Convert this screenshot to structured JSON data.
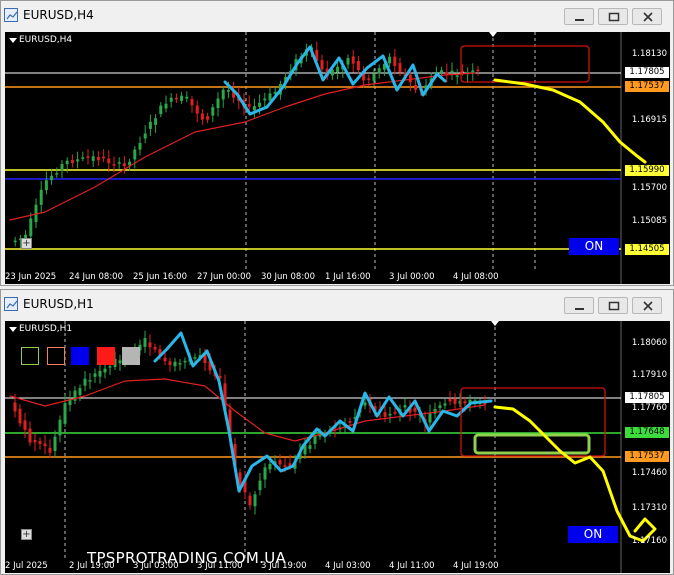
{
  "windows": [
    {
      "title": "EURUSD,H4",
      "chart_label": "EURUSD,H4",
      "price_ticks": [
        "1.18130",
        "1.16915",
        "1.15700",
        "1.15085"
      ],
      "price_badges": [
        {
          "label": "1.17805",
          "color": "#ffffff"
        },
        {
          "label": "1.17537",
          "color": "#ff9a1f"
        },
        {
          "label": "1.15990",
          "color": "#ffff33"
        },
        {
          "label": "1.14505",
          "color": "#ffff33"
        }
      ],
      "time_ticks": [
        "23 Jun 2025",
        "24 Jun 08:00",
        "25 Jun 16:00",
        "27 Jun 00:00",
        "30 Jun 08:00",
        "1 Jul 16:00",
        "3 Jul 00:00",
        "4 Jul 08:00"
      ],
      "on_label": "ON"
    },
    {
      "title": "EURUSD,H1",
      "chart_label": "EURUSD,H1",
      "price_ticks": [
        "1.18060",
        "1.17910",
        "1.17760",
        "1.17460",
        "1.17310",
        "1.17160"
      ],
      "price_badges": [
        {
          "label": "1.17805",
          "color": "#ffffff"
        },
        {
          "label": "1.17648",
          "color": "#3ddc3d"
        },
        {
          "label": "1.17537",
          "color": "#ff9a1f"
        }
      ],
      "time_ticks": [
        "2 Jul 2025",
        "2 Jul 19:00",
        "3 Jul 03:00",
        "3 Jul 11:00",
        "3 Jul 19:00",
        "4 Jul 03:00",
        "4 Jul 11:00",
        "4 Jul 19:00"
      ],
      "on_label": "ON",
      "watermark": "TPSPROTRADING.COM.UA"
    }
  ],
  "colors": {
    "bull": "#2aa84a",
    "bear": "#e02020",
    "ma": "#e02020",
    "trend": "#29b6e8",
    "forecast": "#ffff00",
    "box": "#cc1111",
    "target_box": "#8fd14f"
  }
}
